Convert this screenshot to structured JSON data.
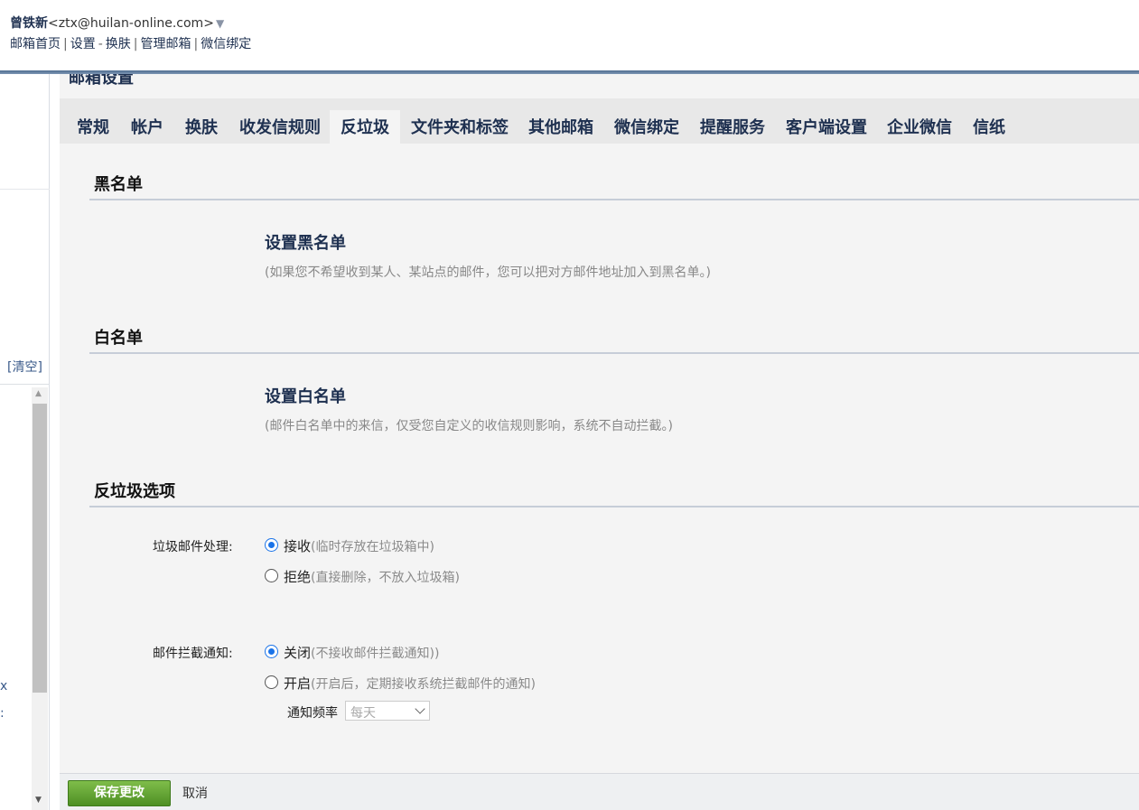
{
  "header": {
    "user_name": "曾铁新",
    "user_email": "<ztx@huilan-online.com>",
    "user_arrow": "▼",
    "nav": {
      "home": "邮箱首页",
      "settings": "设置",
      "skin": "换肤",
      "manage": "管理邮箱",
      "wechat": "微信绑定",
      "sep_pipe": "|",
      "sep_dash": "-"
    }
  },
  "left_panel": {
    "clear_link": "[清空]",
    "fragment_x": "x",
    "fragment_c": ":"
  },
  "main": {
    "title": "邮箱设置",
    "tabs": [
      {
        "label": "常规"
      },
      {
        "label": "帐户"
      },
      {
        "label": "换肤"
      },
      {
        "label": "收发信规则"
      },
      {
        "label": "反垃圾",
        "active": true
      },
      {
        "label": "文件夹和标签"
      },
      {
        "label": "其他邮箱"
      },
      {
        "label": "微信绑定"
      },
      {
        "label": "提醒服务"
      },
      {
        "label": "客户端设置"
      },
      {
        "label": "企业微信"
      },
      {
        "label": "信纸"
      }
    ],
    "blacklist": {
      "heading": "黑名单",
      "link": "设置黑名单",
      "hint": "(如果您不希望收到某人、某站点的邮件，您可以把对方邮件地址加入到黑名单。)"
    },
    "whitelist": {
      "heading": "白名单",
      "link": "设置白名单",
      "hint": "(邮件白名单中的来信，仅受您自定义的收信规则影响，系统不自动拦截。)"
    },
    "antispam": {
      "heading": "反垃圾选项",
      "spam_handling": {
        "label": "垃圾邮件处理:",
        "options": [
          {
            "label": "接收",
            "note": "(临时存放在垃圾箱中)",
            "checked": true
          },
          {
            "label": "拒绝",
            "note": "(直接删除，不放入垃圾箱)",
            "checked": false
          }
        ]
      },
      "intercept_notice": {
        "label": "邮件拦截通知:",
        "options": [
          {
            "label": "关闭",
            "note": "(不接收邮件拦截通知))",
            "checked": true
          },
          {
            "label": "开启",
            "note": "(开启后，定期接收系统拦截邮件的通知)",
            "checked": false
          }
        ],
        "frequency_label": "通知频率",
        "frequency_value": "每天"
      }
    },
    "footer": {
      "save": "保存更改",
      "cancel": "取消"
    }
  },
  "colors": {
    "accent_navy": "#1e3050",
    "radio_blue": "#1a73e8",
    "save_green": "#5a9e2f"
  }
}
